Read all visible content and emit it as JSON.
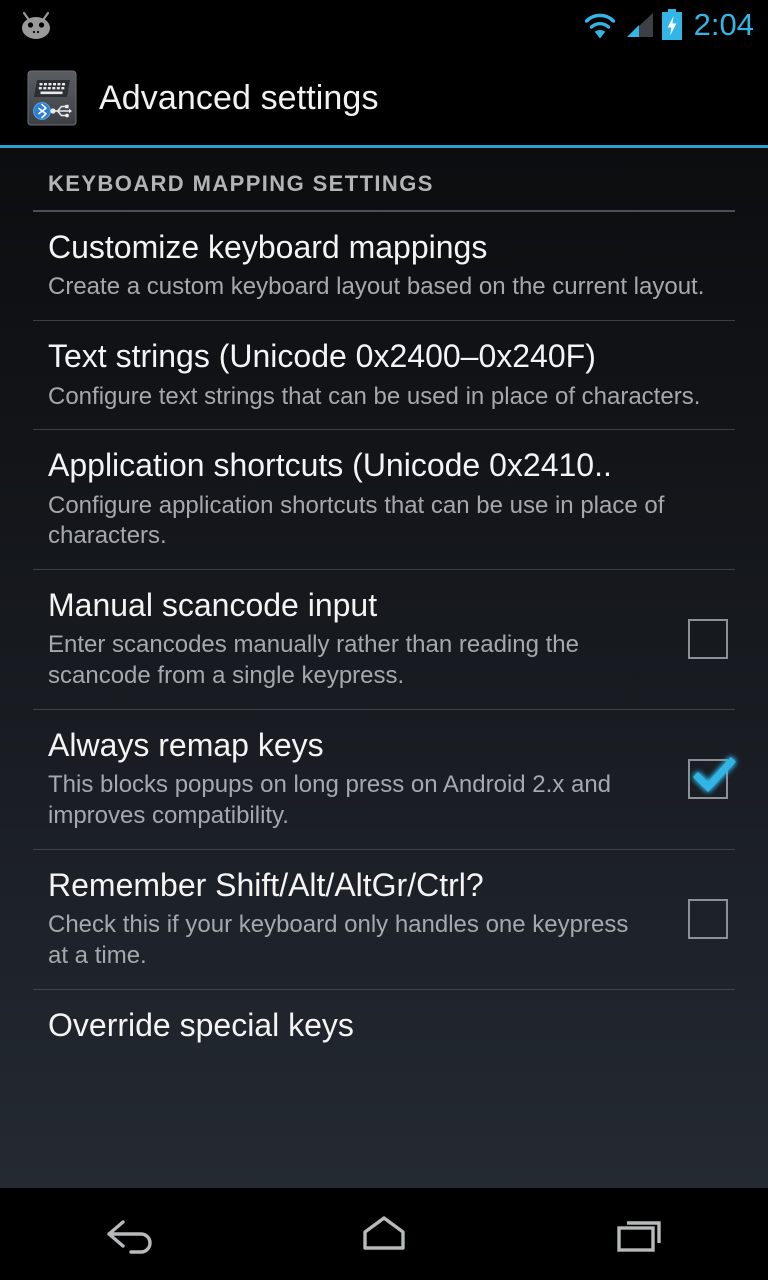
{
  "status_bar": {
    "logo_icon": "android-bugdroid-icon",
    "wifi_icon": "wifi-icon",
    "signal_icon": "cellular-signal-icon",
    "battery_icon": "battery-charging-icon",
    "clock": "2:04",
    "accent_color": "#33b5e5"
  },
  "action_bar": {
    "app_icon": "keyboard-bluetooth-usb-icon",
    "title": "Advanced settings",
    "underline_color": "#2f9fd0"
  },
  "section": {
    "header": "KEYBOARD MAPPING SETTINGS"
  },
  "preferences": [
    {
      "title": "Customize keyboard mappings",
      "summary": "Create a custom keyboard layout based on the current layout.",
      "widget": "none",
      "checked": false
    },
    {
      "title": "Text strings (Unicode 0x2400–0x240F)",
      "summary": "Configure text strings that can be used in place of characters.",
      "widget": "none",
      "checked": false
    },
    {
      "title": "Application shortcuts (Unicode 0x2410..",
      "summary": "Configure application shortcuts that can be use in place of characters.",
      "widget": "none",
      "checked": false
    },
    {
      "title": "Manual scancode input",
      "summary": "Enter scancodes manually rather than reading the scancode from a single keypress.",
      "widget": "checkbox",
      "checked": false
    },
    {
      "title": "Always remap keys",
      "summary": "This blocks popups on long press on Android 2.x and improves compatibility.",
      "widget": "checkbox",
      "checked": true
    },
    {
      "title": "Remember Shift/Alt/AltGr/Ctrl?",
      "summary": "Check this if your keyboard only handles one keypress at a time.",
      "widget": "checkbox",
      "checked": false
    },
    {
      "title": "Override special keys",
      "summary": "",
      "widget": "none",
      "checked": false
    }
  ],
  "nav_bar": {
    "back": "back-icon",
    "home": "home-icon",
    "recents": "recent-apps-icon"
  }
}
